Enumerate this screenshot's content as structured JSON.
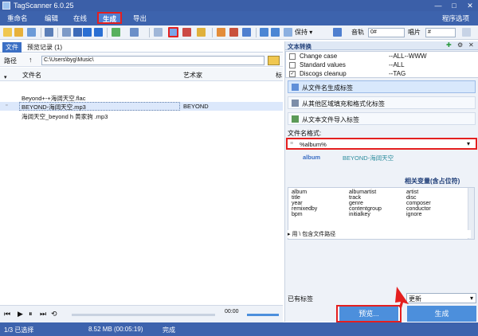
{
  "app": {
    "title": "TagScanner 6.0.25",
    "min": "—",
    "max": "□",
    "close": "✕"
  },
  "menu": {
    "items": [
      "重命名",
      "编辑",
      "在线",
      "生成",
      "导出"
    ],
    "settings": "程序选项"
  },
  "toolbar": {
    "keep_label": "保持",
    "track_label": "音轨",
    "track_value": "0#",
    "disc_label": "唱片",
    "disc_value": "#"
  },
  "left": {
    "tabs": [
      "文件",
      "预览记录 (1)"
    ],
    "path_label": "路径",
    "path_value": "C:\\Users\\byg\\Music\\",
    "columns": [
      "文件名",
      "艺术家",
      "标"
    ],
    "rows": [
      {
        "file": "Beyond+-+海阔天空.flac",
        "artist": ""
      },
      {
        "file": "BEYOND-海阔天空.mp3",
        "artist": "BEYOND"
      },
      {
        "file": "海阔天空_beyond h 黄家驹 .mp3",
        "artist": ""
      }
    ],
    "player": {
      "time": "00:00"
    }
  },
  "right": {
    "header": "文本转换",
    "conversions": [
      {
        "name": "Change case",
        "target": "--ALL--WWW",
        "checked": false
      },
      {
        "name": "Standard values",
        "target": "--ALL",
        "checked": false
      },
      {
        "name": "Discogs cleanup",
        "target": "--TAG",
        "checked": true
      }
    ],
    "actions": [
      "从文件名生成标签",
      "从其他区域填充和格式化标签",
      "从文本文件导入标签"
    ],
    "format_label": "文件名格式:",
    "format_value": "%album%",
    "preview_key": "album",
    "preview_value": "BEYOND-海阔天空",
    "vars_title": "相关变量(含占位符)",
    "vars": [
      [
        "album",
        "albumartist",
        "artist"
      ],
      [
        "title",
        "track",
        "disc"
      ],
      [
        "year",
        "genre",
        "composer"
      ],
      [
        "remixedby",
        "contentgroup",
        "conductor"
      ],
      [
        "bpm",
        "initialkey",
        "ignore"
      ]
    ],
    "include_path": "用 \\ 包含文件路径",
    "existing_tags_label": "已有标签",
    "mode_value": "更新",
    "preview_button": "预览...",
    "generate_button": "生成"
  },
  "status": {
    "selected": "1/3 已选择",
    "size": "8.52 MB (00:05:19)",
    "state": "完成"
  },
  "colors": {
    "accent": "#3d63ad",
    "highlight": "#e41f1f",
    "button": "#4c8fdc"
  }
}
